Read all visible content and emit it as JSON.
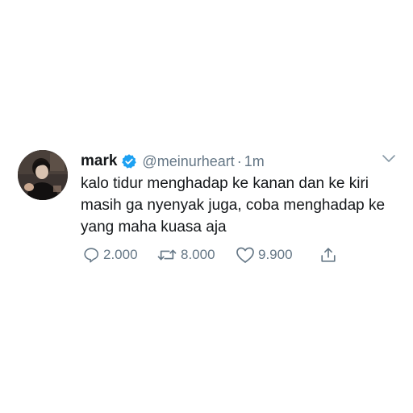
{
  "tweet": {
    "display_name": "mark",
    "handle": "@meinurheart",
    "separator": "·",
    "time": "1m",
    "text": "kalo tidur menghadap ke kanan dan ke kiri masih ga nyenyak juga, coba menghadap ke yang maha kuasa aja",
    "replies": "2.000",
    "retweets": "8.000",
    "likes": "9.900",
    "verified": true
  },
  "icons": {
    "verified": "verified-badge-icon",
    "caret": "chevron-down-icon",
    "reply": "reply-icon",
    "retweet": "retweet-icon",
    "like": "heart-icon",
    "share": "share-icon"
  },
  "colors": {
    "verified_blue": "#1da1f2",
    "secondary_text": "#657786",
    "primary_text": "#14171a"
  }
}
